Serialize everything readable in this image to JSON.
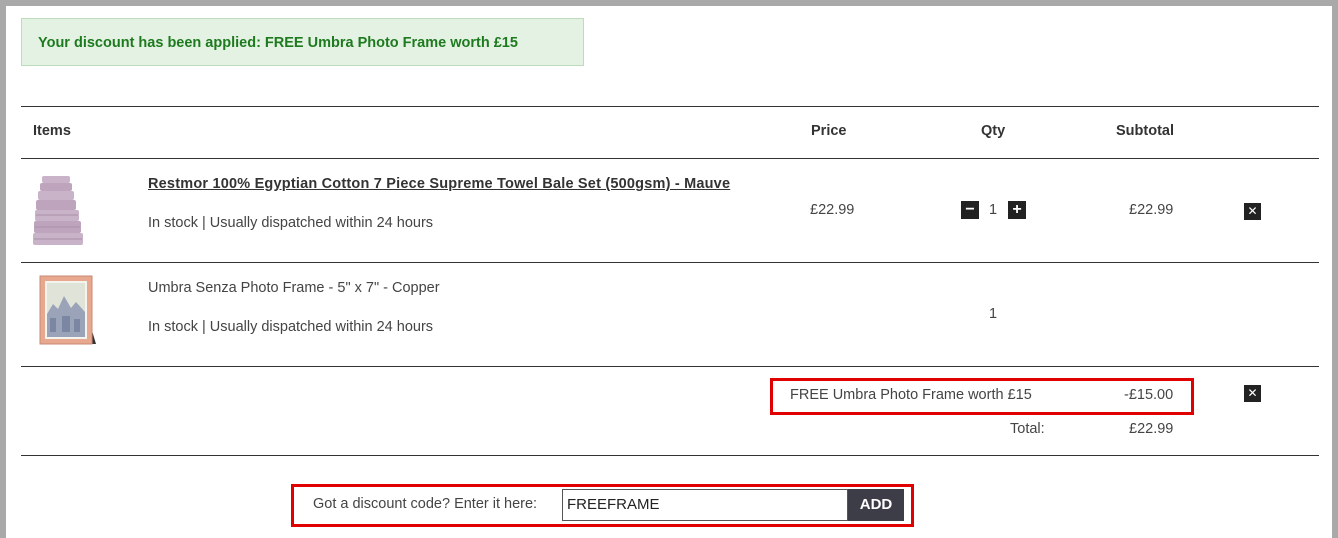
{
  "banner": {
    "message": "Your discount has been applied: FREE Umbra Photo Frame worth £15"
  },
  "table": {
    "headers": {
      "items": "Items",
      "price": "Price",
      "qty": "Qty",
      "subtotal": "Subtotal"
    },
    "rows": [
      {
        "name": "Restmor 100% Egyptian Cotton 7 Piece Supreme Towel Bale Set (500gsm) - Mauve",
        "stock": "In stock | Usually dispatched within 24 hours",
        "price": "£22.99",
        "qty": "1",
        "subtotal": "£22.99",
        "thumb_icon": "towel-set-thumbnail"
      },
      {
        "name": "Umbra Senza Photo Frame - 5\" x 7\" - Copper",
        "stock": "In stock | Usually dispatched within 24 hours",
        "qty": "1",
        "thumb_icon": "photo-frame-thumbnail"
      }
    ]
  },
  "totals": {
    "discount_label": "FREE Umbra Photo Frame worth £15",
    "discount_value": "-£15.00",
    "total_label": "Total:",
    "total_value": "£22.99"
  },
  "discount_code": {
    "prompt": "Got a discount code? Enter it here:",
    "value": "FREEFRAME",
    "button": "ADD"
  },
  "icons": {
    "minus": "minus-icon",
    "plus": "plus-icon",
    "remove": "close-icon"
  },
  "colors": {
    "banner_bg": "#e4f2e4",
    "banner_text": "#1e7a1e",
    "highlight": "#e00000",
    "add_button": "#3d3d47"
  }
}
